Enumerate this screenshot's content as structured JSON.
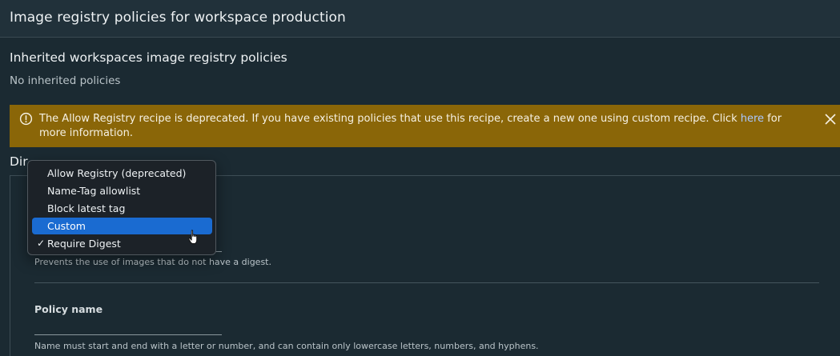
{
  "page": {
    "title": "Image registry policies for workspace production"
  },
  "inherited": {
    "title": "Inherited workspaces image registry policies",
    "empty_text": "No inherited policies"
  },
  "alert": {
    "text_before": "The Allow Registry recipe is deprecated. If you have existing policies that use this recipe, create a new one using custom recipe. Click ",
    "link_text": "here",
    "text_after": " for more information.",
    "icon": "info-circle-icon",
    "close_icon": "close-icon",
    "color": "#8a6608"
  },
  "direct": {
    "title_visible": "Dir"
  },
  "form": {
    "recipe_helper": "Prevents the use of images that do not have a digest.",
    "policy_name_label": "Policy name",
    "policy_name_value": "",
    "policy_name_helper": "Name must start and end with a letter or number, and can contain only lowercase letters, numbers, and hyphens."
  },
  "recipe_dropdown": {
    "options": [
      {
        "label": "Allow Registry (deprecated)",
        "checked": false,
        "highlighted": false
      },
      {
        "label": "Name-Tag allowlist",
        "checked": false,
        "highlighted": false
      },
      {
        "label": "Block latest tag",
        "checked": false,
        "highlighted": false
      },
      {
        "label": "Custom",
        "checked": false,
        "highlighted": true
      },
      {
        "label": "Require Digest",
        "checked": true,
        "highlighted": false
      }
    ],
    "check_mark": "✓",
    "highlight_color": "#1a6bd1"
  }
}
